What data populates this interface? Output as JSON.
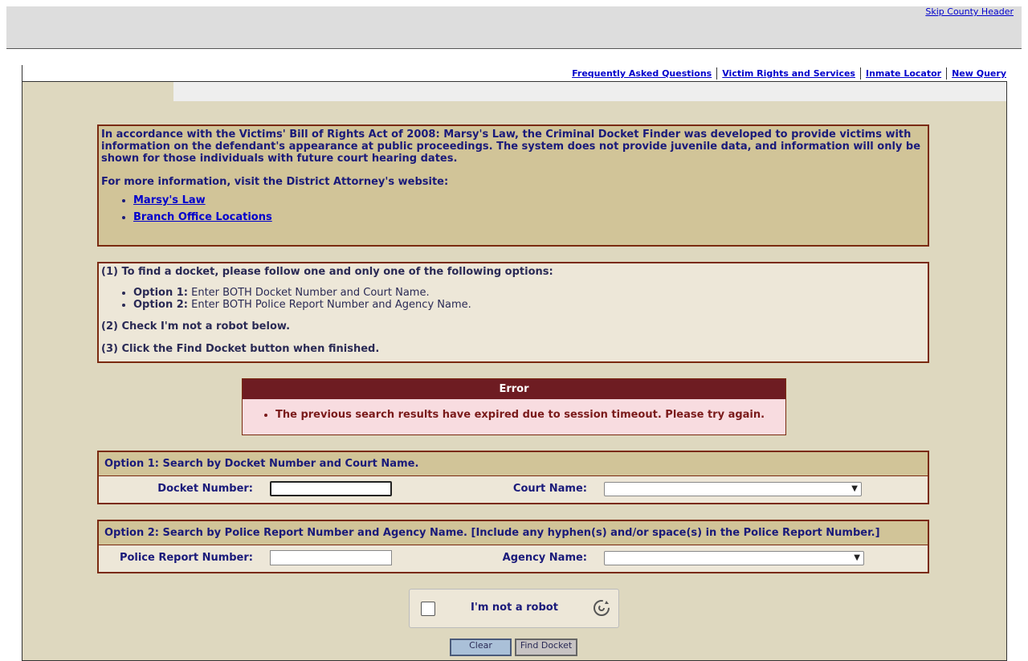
{
  "header": {
    "skip_link": "Skip County Header"
  },
  "nav": {
    "items": [
      {
        "label": "Frequently Asked Questions"
      },
      {
        "label": "Victim Rights and Services"
      },
      {
        "label": "Inmate Locator"
      },
      {
        "label": "New Query"
      }
    ]
  },
  "intro": {
    "paragraph1": "In accordance with the Victims' Bill of Rights Act of 2008:  Marsy's Law, the Criminal Docket Finder was developed to provide victims with information on the defendant's appearance at public proceedings.  The system does not provide juvenile data, and information will only be shown for those individuals with future court hearing dates.",
    "paragraph2": "For more information, visit the District Attorney's website:",
    "links": [
      {
        "label": "Marsy's Law"
      },
      {
        "label": "Branch Office Locations"
      }
    ]
  },
  "steps": {
    "step1": "(1) To find a docket, please follow one and only one of the following options:",
    "options": [
      {
        "name": "Option 1:",
        "text": " Enter BOTH Docket Number and Court Name."
      },
      {
        "name": "Option 2:",
        "text": " Enter BOTH Police Report Number and Agency Name."
      }
    ],
    "step2": "(2) Check I'm not a robot below.",
    "step3": "(3) Click the Find Docket button when finished."
  },
  "error": {
    "title": "Error",
    "message": "The previous search results have expired due to session timeout.  Please try again."
  },
  "option1": {
    "heading": "Option 1:  Search by Docket Number and Court Name.",
    "docket_label": "Docket Number:",
    "docket_value": "",
    "court_label": "Court Name:",
    "court_selected": ""
  },
  "option2": {
    "heading": "Option 2:  Search by Police Report Number and Agency Name.  [Include any hyphen(s) and/or space(s) in the Police Report Number.]",
    "report_label": "Police Report Number:",
    "report_value": "",
    "agency_label": "Agency Name:",
    "agency_selected": ""
  },
  "captcha": {
    "label": "I'm not a robot",
    "checked": false,
    "icon": "refresh-icon"
  },
  "buttons": {
    "clear": "Clear",
    "find": "Find Docket"
  },
  "colors": {
    "page_bg": "#ded8bf",
    "panel_tan": "#d1c498",
    "panel_light": "#ede7d8",
    "border": "#7a2a10",
    "error_head": "#6e1c22",
    "error_bg": "#f8dce0",
    "link": "#0000cc",
    "text_navy": "#1a1a7a"
  }
}
